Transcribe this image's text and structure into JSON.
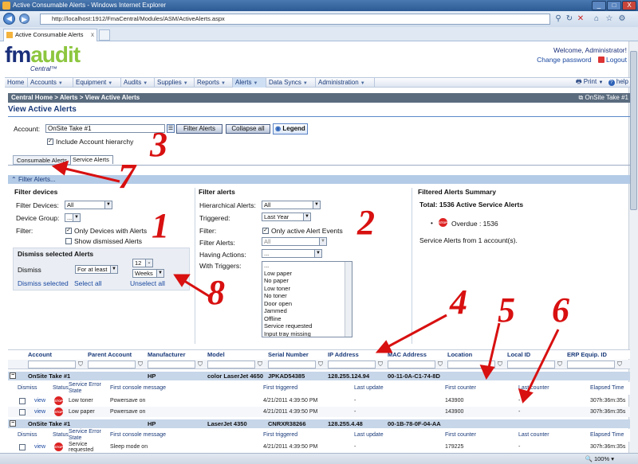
{
  "window": {
    "title": "Active Consumable Alerts - Windows Internet Explorer",
    "min": "_",
    "max": "□",
    "close": "X"
  },
  "browser": {
    "url": "http://localhost:1912/FmaCentral/Modules/ASM/ActiveAlerts.aspx",
    "tab_label": "Active Consumable Alerts",
    "tab_close": "x"
  },
  "app": {
    "brand_fm": "fm",
    "brand_audit": "audit",
    "brand_sub": "Central™",
    "welcome": "Welcome, Administrator!",
    "change_password": "Change password",
    "logout": "Logout"
  },
  "menu": {
    "items": [
      "Home",
      "Accounts",
      "Equipment",
      "Audits",
      "Supplies",
      "Reports",
      "Alerts",
      "Data Syncs",
      "Administration"
    ],
    "print": "Print",
    "help": "help"
  },
  "breadcrumb": {
    "path": "Central Home > Alerts > View Active Alerts",
    "onsite": "OnSite Take #1"
  },
  "page": {
    "title": "View Active Alerts"
  },
  "account": {
    "label": "Account:",
    "value": "OnSite Take #1",
    "include_hierarchy": "Include Account hierarchy",
    "filter_btn": "Filter Alerts",
    "collapse_btn": "Collapse all",
    "legend_btn": "Legend"
  },
  "subtabs": [
    "Consumable Alerts",
    "Service Alerts"
  ],
  "filter_bar": "Filter Alerts...",
  "filter_devices": {
    "title": "Filter devices",
    "filter_devices_label": "Filter Devices:",
    "filter_devices_value": "All",
    "device_group_label": "Device Group:",
    "device_group_value": "...",
    "filter_label": "Filter:",
    "only_devices": "Only Devices with Alerts",
    "show_dismissed": "Show dismissed Alerts"
  },
  "dismiss": {
    "title": "Dismiss selected Alerts",
    "label": "Dismiss",
    "mode": "For at least",
    "count": "12",
    "unit": "Weeks",
    "dismiss_selected": "Dismiss selected",
    "select_all": "Select all",
    "unselect_all": "Unselect all"
  },
  "filter_alerts": {
    "title": "Filter alerts",
    "hier_label": "Hierarchical Alerts:",
    "hier_value": "All",
    "triggered_label": "Triggered:",
    "triggered_value": "Last Year",
    "filter_label": "Filter:",
    "only_active": "Only active Alert Events",
    "filter_alerts_label": "Filter Alerts:",
    "filter_alerts_value": "All",
    "having_label": "Having Actions:",
    "having_value": "...",
    "triggers_label": "With Triggers:",
    "triggers": [
      "...",
      "Low paper",
      "No paper",
      "Low toner",
      "No toner",
      "Door open",
      "Jammed",
      "Offline",
      "Service requested",
      "Input tray missing"
    ]
  },
  "summary": {
    "title": "Filtered Alerts Summary",
    "total": "Total: 1536 Active Service Alerts",
    "overdue": "Overdue : 1536",
    "stop": "STOP",
    "from": "Service Alerts from 1 account(s)."
  },
  "grid": {
    "columns": [
      "Account",
      "Parent Account",
      "Manufacturer",
      "Model",
      "Serial Number",
      "IP Address",
      "MAC Address",
      "Location",
      "Local ID",
      "ERP Equip. ID"
    ],
    "sub_columns": [
      "Dismiss",
      "Status",
      "Service Error State",
      "First console message",
      "First triggered",
      "Last update",
      "First counter",
      "Last counter",
      "Elapsed Time"
    ],
    "groups": [
      {
        "account": "OnSite Take #1",
        "manufacturer": "HP",
        "model": "color LaserJet 4650",
        "serial": "JPKAD54385",
        "ip": "128.255.124.94",
        "mac": "00-11-0A-C1-74-8D",
        "rows": [
          {
            "action": "view",
            "state": "Low toner",
            "message": "Powersave on",
            "first_triggered": "4/21/2011 4:39:50 PM",
            "last_update": "-",
            "first_counter": "143900",
            "last_counter": "-",
            "elapsed": "307h:36m:35s"
          },
          {
            "action": "view",
            "state": "Low paper",
            "message": "Powersave on",
            "first_triggered": "4/21/2011 4:39:50 PM",
            "last_update": "-",
            "first_counter": "143900",
            "last_counter": "-",
            "elapsed": "307h:36m:35s"
          }
        ]
      },
      {
        "account": "OnSite Take #1",
        "manufacturer": "HP",
        "model": "LaserJet 4350",
        "serial": "CNRXR38266",
        "ip": "128.255.4.48",
        "mac": "00-1B-78-0F-04-AA",
        "rows": [
          {
            "action": "view",
            "state": "Service requested",
            "message": "Sleep mode on",
            "first_triggered": "4/21/2011 4:39:50 PM",
            "last_update": "-",
            "first_counter": "179225",
            "last_counter": "-",
            "elapsed": "307h:36m:35s"
          }
        ]
      }
    ]
  },
  "annotations": [
    "1",
    "2",
    "3",
    "4",
    "5",
    "6",
    "7",
    "8"
  ],
  "status": {
    "zoom": "100%"
  }
}
